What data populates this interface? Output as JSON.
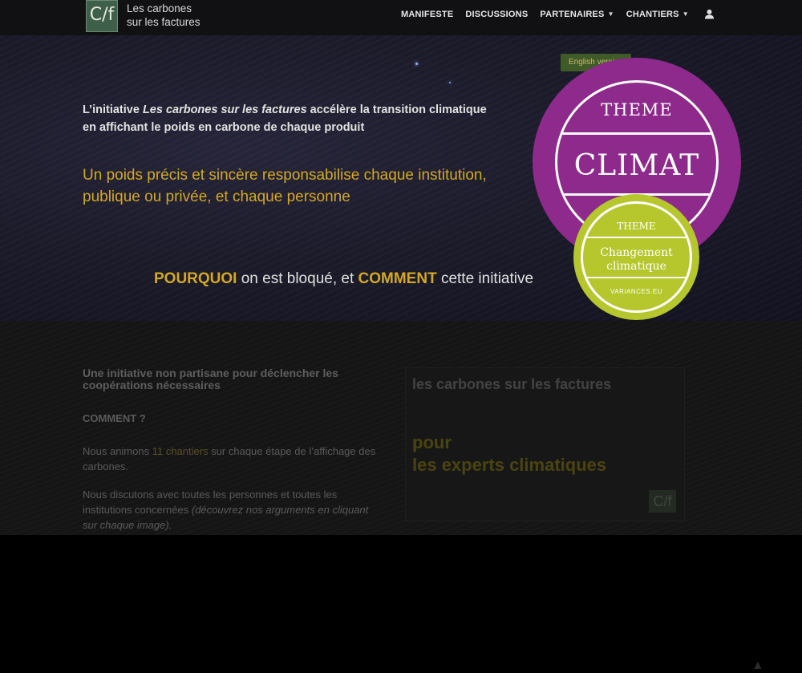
{
  "header": {
    "logo_mark": "C/f",
    "logo_line1": "Les carbones",
    "logo_line2": "sur les factures",
    "menu": [
      {
        "label": "MANIFESTE"
      },
      {
        "label": "DISCUSSIONS"
      },
      {
        "label": "PARTENAIRES"
      },
      {
        "label": "CHANTIERS"
      }
    ]
  },
  "hero": {
    "english_button": "English version",
    "intro_pre": "L’initiative ",
    "intro_em": "Les carbones sur les factures",
    "intro_post": " accélère la transition climatique en affichant le poids en carbone de chaque produit",
    "subline": "Un poids précis et sincère responsabilise chaque institution, publique ou privée, et chaque personne",
    "q_word1": "POURQUOI",
    "q_mid": " on est bloqué, et ",
    "q_word2": "COMMENT",
    "q_end": " cette initiative"
  },
  "lower": {
    "heading": "Une initiative non partisane pour déclencher les coopérations nécessaires",
    "comment": "COMMENT ?",
    "p1_pre": "Nous animons ",
    "p1_link": "11 chantiers",
    "p1_post": " sur chaque étape de l’affichage des carbones.",
    "p2_pre": "Nous discutons avec toutes les personnes et toutes les institutions concernées ",
    "p2_em": "(découvrez nos arguments en cliquant sur chaque image).",
    "promo_title": "les carbones sur les factures",
    "promo_pour": "pour",
    "promo_experts": "les experts climatiques",
    "promo_logo": "C/f"
  },
  "badges": {
    "big_theme": "THEME",
    "big_title": "CLIMAT",
    "small_theme": "THEME",
    "small_line1": "Changement",
    "small_line2": "climatique",
    "small_site": "VARIANCES.EU"
  }
}
